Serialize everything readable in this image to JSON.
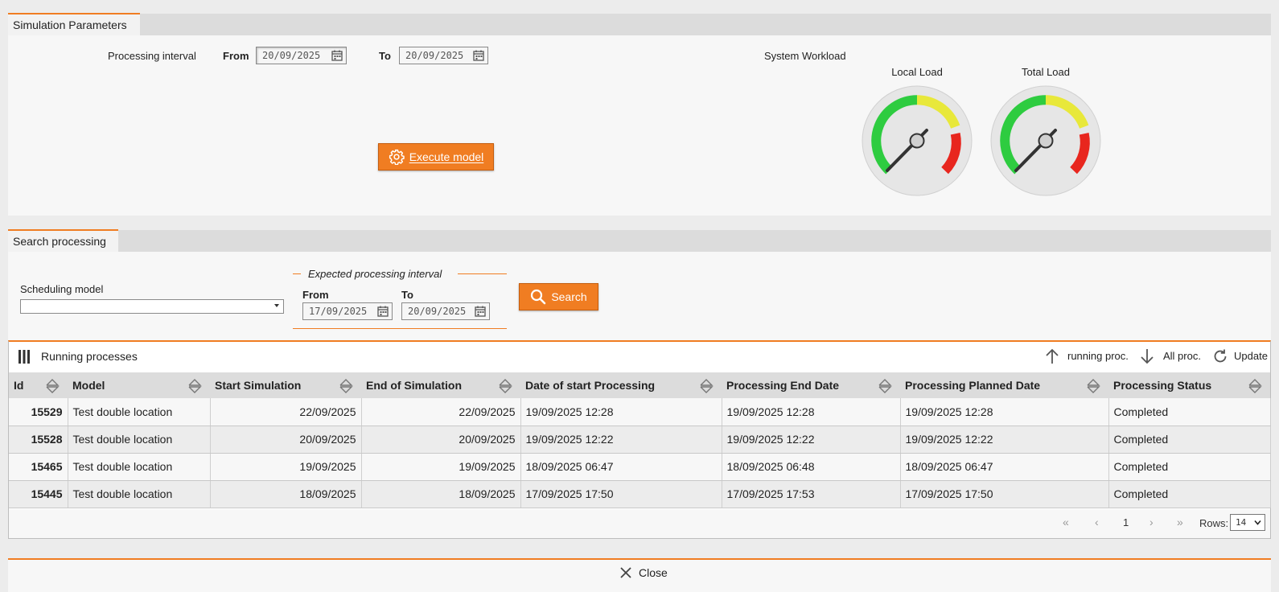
{
  "simulation": {
    "tab_label": "Simulation Parameters",
    "processing_interval_label": "Processing interval",
    "from_label": "From",
    "from_value": "20/09/2025",
    "to_label": "To",
    "to_value": "20/09/2025",
    "execute_label": "Execute model",
    "workload_label": "System Workload",
    "gauges": [
      {
        "title": "Local Load",
        "value_fraction": 0.1
      },
      {
        "title": "Total Load",
        "value_fraction": 0.1
      }
    ]
  },
  "search": {
    "tab_label": "Search processing",
    "scheduling_model_label": "Scheduling model",
    "scheduling_model_value": "",
    "interval_legend": "Expected processing interval",
    "from_label": "From",
    "from_value": "17/09/2025",
    "to_label": "To",
    "to_value": "20/09/2025",
    "search_label": "Search"
  },
  "grid": {
    "title": "Running processes",
    "running_label": "running proc.",
    "all_label": "All proc.",
    "update_label": "Update",
    "columns": [
      "Id",
      "Model",
      "Start Simulation",
      "End of Simulation",
      "Date of start Processing",
      "Processing End Date",
      "Processing Planned Date",
      "Processing Status"
    ],
    "rows": [
      [
        "15529",
        "Test double location",
        "22/09/2025",
        "22/09/2025",
        "19/09/2025 12:28",
        "19/09/2025 12:28",
        "19/09/2025 12:28",
        "Completed"
      ],
      [
        "15528",
        "Test double location",
        "20/09/2025",
        "20/09/2025",
        "19/09/2025 12:22",
        "19/09/2025 12:22",
        "19/09/2025 12:22",
        "Completed"
      ],
      [
        "15465",
        "Test double location",
        "19/09/2025",
        "19/09/2025",
        "18/09/2025 06:47",
        "18/09/2025 06:48",
        "18/09/2025 06:47",
        "Completed"
      ],
      [
        "15445",
        "Test double location",
        "18/09/2025",
        "18/09/2025",
        "17/09/2025 17:50",
        "17/09/2025 17:53",
        "17/09/2025 17:50",
        "Completed"
      ]
    ],
    "pager": {
      "page": "1",
      "rows_label": "Rows:",
      "rows_value": "14"
    }
  },
  "footer": {
    "close_label": "Close"
  },
  "colors": {
    "accent": "#f07d22",
    "gauge_green": "#2ecc40",
    "gauge_yellow": "#e8e83a",
    "gauge_red": "#e8261e"
  }
}
